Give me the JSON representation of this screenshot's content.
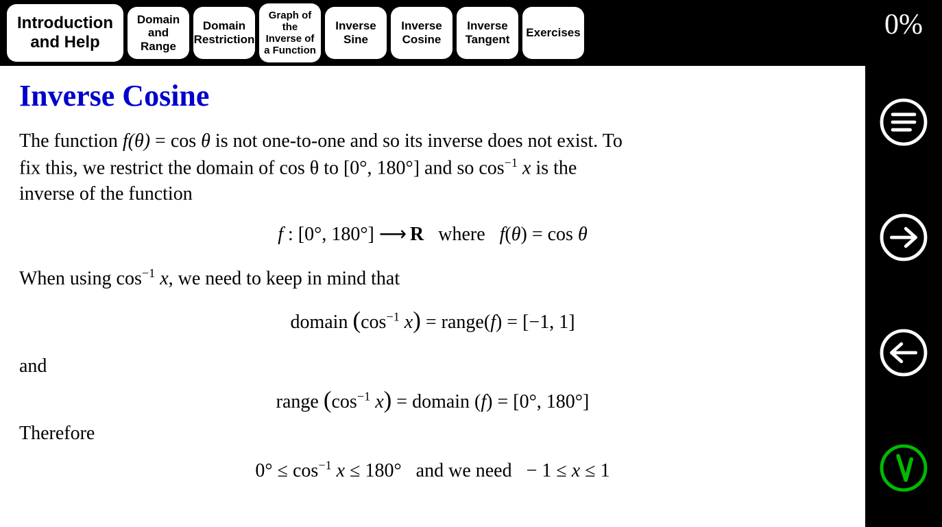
{
  "progress": "0%",
  "tabs": {
    "intro": "Introduction and Help",
    "domain_range": "Domain and Range",
    "domain_restriction": "Domain Restriction",
    "graph_inverse": "Graph of the Inverse of a Function",
    "inv_sine": "Inverse Sine",
    "inv_cosine": "Inverse Cosine",
    "inv_tangent": "Inverse Tangent",
    "exercises": "Exercises"
  },
  "title": "Inverse Cosine",
  "body": {
    "p1_a": "The function ",
    "p1_fn": "f(θ) = cos θ",
    "p1_b": " is not one-to-one and so its inverse does not exist. To fix this, we restrict the domain of cos θ to [0°, 180°] and so cos",
    "p1_sup": "−1",
    "p1_c": " x is the inverse of the function",
    "eq1": "f : [0°, 180°] ⟶ R   where   f(θ) = cos θ",
    "p2_a": "When using cos",
    "p2_sup": "−1",
    "p2_b": " x, we need to keep in mind that",
    "eq2": "domain (cos⁻¹ x) = range(f) = [−1, 1]",
    "p_and": "and",
    "eq3": "range (cos⁻¹ x) = domain (f) = [0°, 180°]",
    "p_therefore": "Therefore",
    "eq4": "0° ≤ cos⁻¹ x ≤ 180°   and we need   − 1 ≤ x ≤ 1"
  },
  "sidebar": {
    "menu": "menu",
    "next": "next",
    "prev": "previous",
    "check": "check"
  }
}
